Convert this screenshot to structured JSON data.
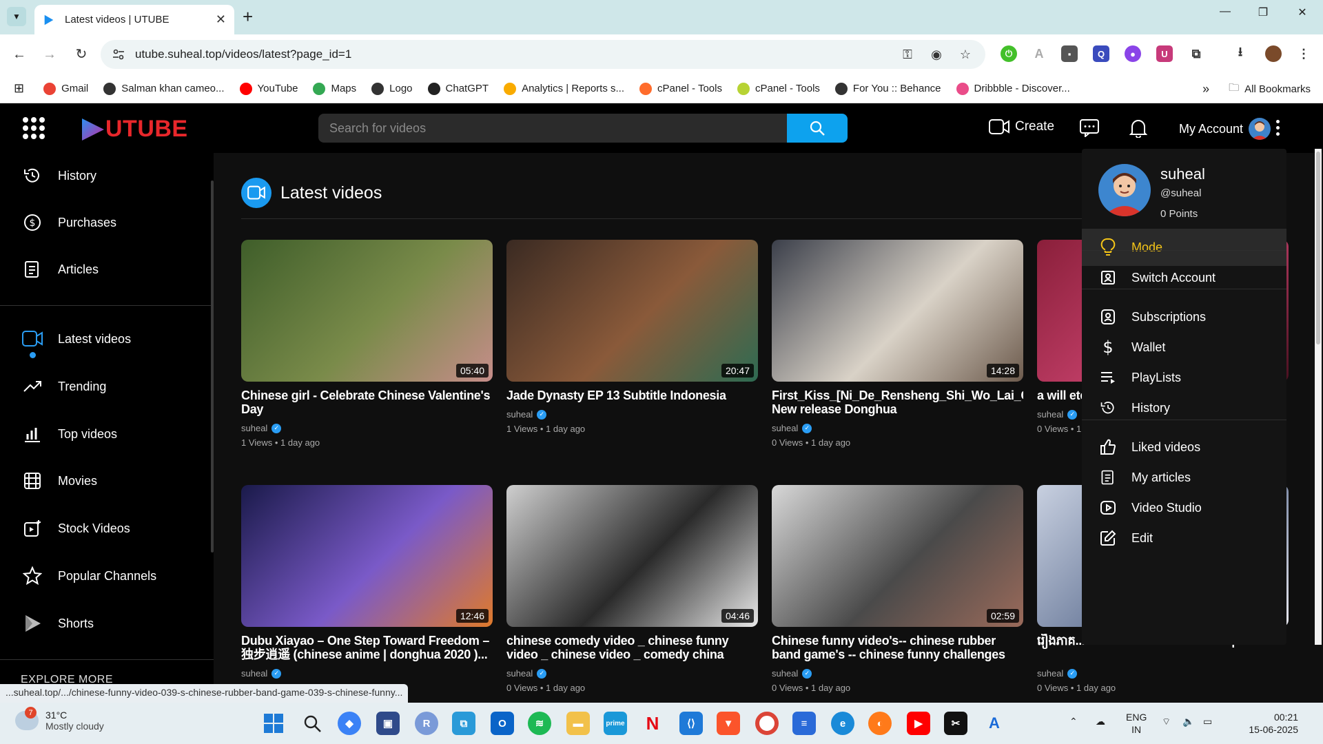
{
  "browser": {
    "tab_title": "Latest videos | UTUBE",
    "url": "utube.suheal.top/videos/latest?page_id=1",
    "bookmarks": [
      {
        "label": "Gmail",
        "color": "#ea4335"
      },
      {
        "label": "Salman khan cameo...",
        "color": "#333333"
      },
      {
        "label": "YouTube",
        "color": "#ff0000"
      },
      {
        "label": "Maps",
        "color": "#34a853"
      },
      {
        "label": "Logo",
        "color": "#333333"
      },
      {
        "label": "ChatGPT",
        "color": "#222222"
      },
      {
        "label": "Analytics | Reports s...",
        "color": "#f9ab00"
      },
      {
        "label": "cPanel - Tools",
        "color": "#ff6c2c"
      },
      {
        "label": "cPanel - Tools",
        "color": "#b7d334"
      },
      {
        "label": "For You :: Behance",
        "color": "#333333"
      },
      {
        "label": "Dribbble - Discover...",
        "color": "#ea4c89"
      }
    ],
    "all_bookmarks": "All Bookmarks"
  },
  "site": {
    "logo_text": "UTUBE",
    "search_placeholder": "Search for videos",
    "create_label": "Create",
    "account_label": "My Account"
  },
  "sidebar": {
    "items_top": [
      {
        "label": "History",
        "icon": "history-icon"
      },
      {
        "label": "Purchases",
        "icon": "dollar-icon"
      },
      {
        "label": "Articles",
        "icon": "articles-icon"
      }
    ],
    "items_main": [
      {
        "label": "Latest videos",
        "icon": "video-camera-icon",
        "active": true
      },
      {
        "label": "Trending",
        "icon": "trending-icon"
      },
      {
        "label": "Top videos",
        "icon": "bar-chart-icon"
      },
      {
        "label": "Movies",
        "icon": "film-icon"
      },
      {
        "label": "Stock Videos",
        "icon": "stock-video-icon"
      },
      {
        "label": "Popular Channels",
        "icon": "star-icon"
      },
      {
        "label": "Shorts",
        "icon": "shorts-icon"
      }
    ],
    "explore_label": "EXPLORE MORE"
  },
  "main": {
    "page_title": "Latest videos",
    "videos": [
      {
        "title": "Chinese girl - Celebrate Chinese Valentine's Day",
        "duration": "05:40",
        "channel": "suheal",
        "meta": "1 Views • 1 day ago",
        "colors": [
          "#3f5e2a",
          "#7a8b4a",
          "#c68d8a"
        ]
      },
      {
        "title": "Jade Dynasty EP 13 Subtitle Indonesia",
        "duration": "20:47",
        "channel": "suheal",
        "meta": "1 Views • 1 day ago",
        "colors": [
          "#3a2a22",
          "#8a5a3a",
          "#2e6b52"
        ]
      },
      {
        "title": "First_Kiss_[Ni_De_Rensheng_Shi_Wo_Lai_Chi_Le] New release Donghua",
        "duration": "14:28",
        "channel": "suheal",
        "meta": "0 Views • 1 day ago",
        "colors": [
          "#3b3f4a",
          "#d9d2c7",
          "#6d5b4d"
        ]
      },
      {
        "title": "a will eternal",
        "duration": "",
        "channel": "suheal",
        "meta": "0 Views • 1 day ago",
        "colors": [
          "#8a1f3a",
          "#c4406a",
          "#4a1020"
        ]
      },
      {
        "title": "Dubu Xiayao – One Step Toward Freedom – 独步逍遥 (chinese anime | donghua 2020 )...",
        "duration": "12:46",
        "channel": "suheal",
        "meta": "",
        "colors": [
          "#1a1a4a",
          "#7a5ac8",
          "#e07a2a"
        ]
      },
      {
        "title": "chinese comedy video _ chinese funny video _ chinese video _ comedy china funny video",
        "duration": "04:46",
        "channel": "suheal",
        "meta": "0 Views • 1 day ago",
        "colors": [
          "#cfcfcf",
          "#2a2a2a",
          "#e8e8e8"
        ]
      },
      {
        "title": "Chinese funny video's-- chinese rubber band game's -- chinese funny challenges",
        "duration": "02:59",
        "channel": "suheal",
        "meta": "0 Views • 1 day ago",
        "colors": [
          "#d8d8d8",
          "#4a4a4a",
          "#9a6a5a"
        ]
      },
      {
        "title": "រឿងភាគ... 2015 Chinese Detective episode 3",
        "duration": "",
        "channel": "suheal",
        "meta": "0 Views • 1 day ago",
        "colors": [
          "#c8d0e0",
          "#6a7a9a",
          "#e8e8f0"
        ]
      }
    ],
    "hover_link": "...suheal.top/.../chinese-funny-video-039-s-chinese-rubber-band-game-039-s-chinese-funny..."
  },
  "account_menu": {
    "name": "suheal",
    "handle": "@suheal",
    "points": "0 Points",
    "mode_label": "Mode",
    "mode_color": "#f5c518",
    "items": [
      {
        "label": "Switch Account",
        "icon": "switch-account-icon"
      },
      {
        "label": "Subscriptions",
        "icon": "subscriptions-icon"
      },
      {
        "label": "Wallet",
        "icon": "dollar-icon"
      },
      {
        "label": "PlayLists",
        "icon": "playlist-icon"
      },
      {
        "label": "History",
        "icon": "history-icon"
      },
      {
        "label": "Liked videos",
        "icon": "thumbs-up-icon"
      },
      {
        "label": "My articles",
        "icon": "articles-icon"
      },
      {
        "label": "Video Studio",
        "icon": "video-studio-icon"
      },
      {
        "label": "Edit",
        "icon": "edit-icon"
      }
    ]
  },
  "taskbar": {
    "weather_badge": "7",
    "temperature": "31°C",
    "weather_desc": "Mostly cloudy",
    "lang_top": "ENG",
    "lang_bottom": "IN",
    "time": "00:21",
    "date": "15-06-2025"
  }
}
